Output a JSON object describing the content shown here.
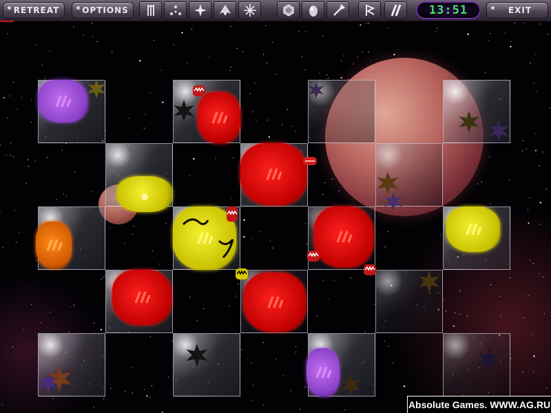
{
  "toolbar": {
    "retreat_label": "RETREAT",
    "options_label": "OPTIONS",
    "exit_label": "EXIT",
    "timer": "13:51",
    "tools": [
      {
        "name": "claw-tool-icon"
      },
      {
        "name": "scatter-tool-icon"
      },
      {
        "name": "burst-tool-icon"
      },
      {
        "name": "ship-tool-icon"
      },
      {
        "name": "sparkle-tool-icon"
      },
      {
        "name": "gem-tool-icon"
      },
      {
        "name": "egg-tool-icon"
      },
      {
        "name": "wrench-tool-icon"
      },
      {
        "name": "flag-tool-icon"
      },
      {
        "name": "stripes-tool-icon"
      }
    ]
  },
  "colors": {
    "red": "#e00000",
    "yellow": "#e0d800",
    "purple": "#9a4ed8",
    "orange": "#f07000",
    "timer_text": "#44e06a",
    "timer_border": "#6b2fa0"
  },
  "watermark": "Absolute Games. WWW.AG.RU"
}
